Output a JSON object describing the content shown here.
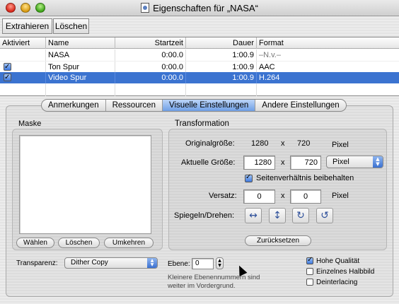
{
  "window": {
    "title": "Eigenschaften für „NASA“"
  },
  "toolbar": {
    "extract_label": "Extrahieren",
    "delete_label": "Löschen"
  },
  "table": {
    "headers": [
      "Aktiviert",
      "Name",
      "Startzeit",
      "Dauer",
      "Format"
    ],
    "rows": [
      {
        "enabled": null,
        "name": "NASA",
        "start": "0:00.0",
        "duration": "1:00.9",
        "format": "–N.v.–"
      },
      {
        "enabled": true,
        "name": "Ton Spur",
        "start": "0:00.0",
        "duration": "1:00.9",
        "format": "AAC"
      },
      {
        "enabled": true,
        "name": "Video Spur",
        "start": "0:00.0",
        "duration": "1:00.9",
        "format": "H.264",
        "selected": true
      }
    ]
  },
  "tabs": [
    "Anmerkungen",
    "Ressourcen",
    "Visuelle Einstellungen",
    "Andere Einstellungen"
  ],
  "active_tab": "Visuelle Einstellungen",
  "mask": {
    "title": "Maske",
    "choose_label": "Wählen",
    "delete_label": "Löschen",
    "invert_label": "Umkehren"
  },
  "transform": {
    "title": "Transformation",
    "original_label": "Originalgröße:",
    "original_w": "1280",
    "original_h": "720",
    "times": "x",
    "pixel": "Pixel",
    "current_label": "Aktuelle Größe:",
    "current_w": "1280",
    "current_h": "720",
    "unit_popup": "Pixel",
    "keep_ratio_label": "Seitenverhältnis beibehalten",
    "keep_ratio_checked": true,
    "offset_label": "Versatz:",
    "offset_x": "0",
    "offset_y": "0",
    "offset_unit": "Pixel",
    "flip_label": "Spiegeln/Drehen:",
    "reset_label": "Zurücksetzen"
  },
  "bottom": {
    "transparency_label": "Transparenz:",
    "transparency_value": "Dither Copy",
    "layer_label": "Ebene:",
    "layer_value": "0",
    "layer_hint": "Kleinere Ebenennummern sind weiter im Vordergrund.",
    "hq_label": "Hohe Qualität",
    "hq_checked": true,
    "single_field_label": "Einzelnes Halbbild",
    "single_field_checked": false,
    "deinterlace_label": "Deinterlacing",
    "deinterlace_checked": false
  },
  "colors": {
    "selection": "#3b73d0",
    "accent": "#3f7ae0"
  }
}
